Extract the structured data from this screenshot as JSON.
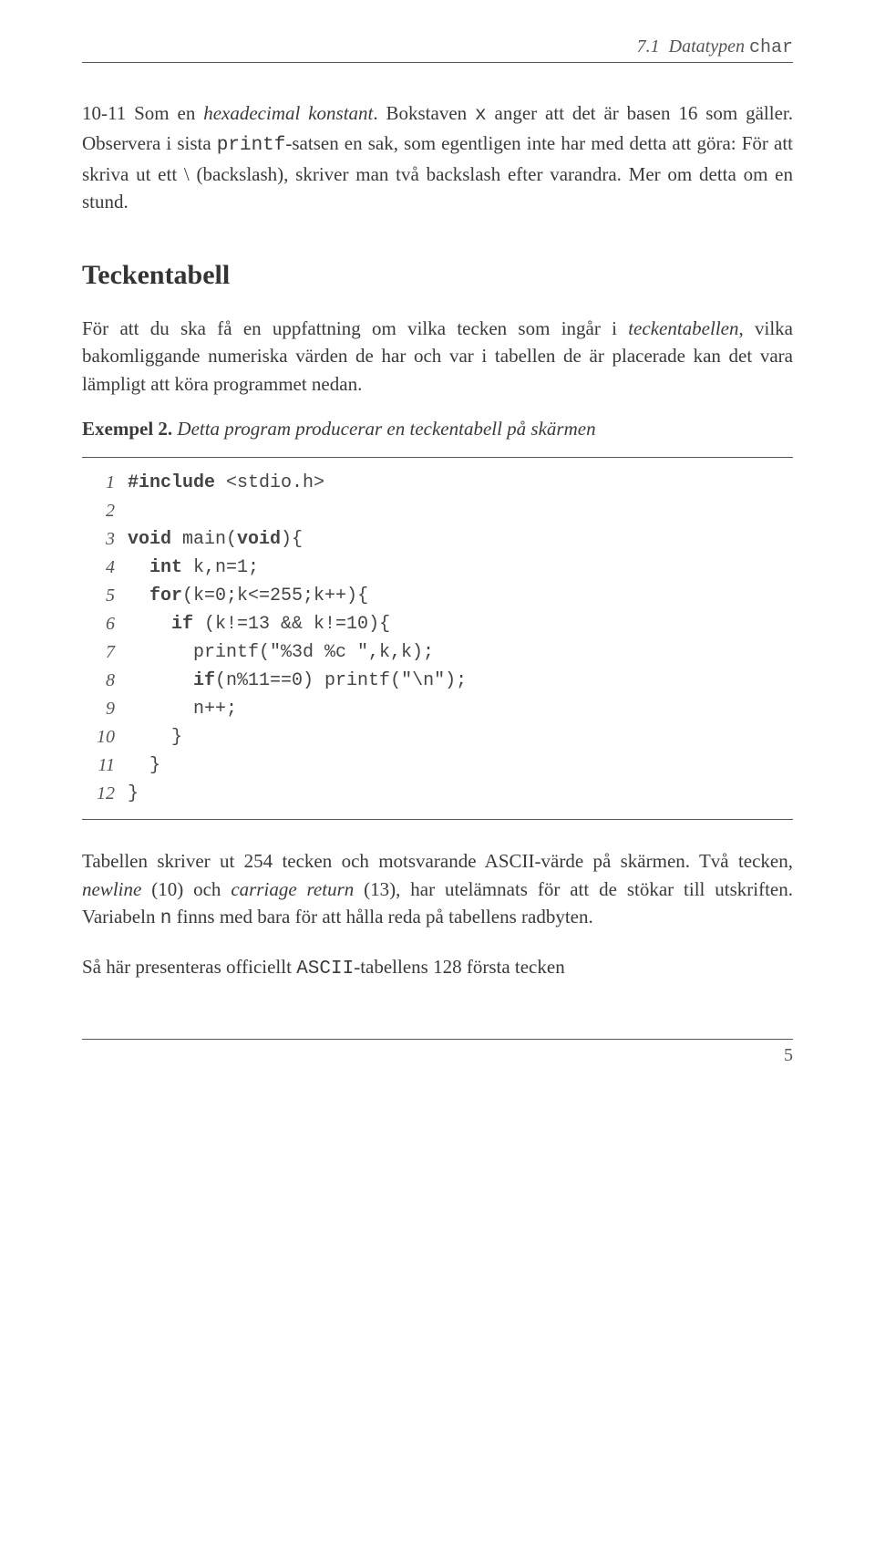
{
  "header": {
    "section_num": "7.1",
    "section_title_pre": "Datatypen ",
    "section_title_mono": "char"
  },
  "para1": {
    "lead_lines": "10-11",
    "t1": " Som en ",
    "i1": "hexadecimal konstant",
    "t2": ". Bokstaven ",
    "m1": "x",
    "t3": " anger att det är basen 16 som gäller. Observera i sista ",
    "m2": "printf",
    "t4": "-satsen en sak, som egentligen inte har med detta att göra: För att skriva ut ett \\ (backslash), skriver man två backslash efter varandra. Mer om detta om en stund."
  },
  "section_title": "Teckentabell",
  "para2": {
    "t1": "För att du ska få en uppfattning om vilka tecken som ingår i ",
    "i1": "teckentabellen",
    "t2": ", vilka bakomliggande numeriska värden de har och var i tabellen de är placerade kan det vara lämpligt att köra programmet nedan."
  },
  "exempel": {
    "label": "Exempel 2.",
    "desc": "Detta program producerar en teckentabell på skärmen"
  },
  "code": [
    {
      "n": "1",
      "pre": "",
      "kw": "#include",
      "post": " <stdio.h>"
    },
    {
      "n": "2",
      "pre": "",
      "kw": "",
      "post": ""
    },
    {
      "n": "3",
      "pre": "",
      "kw": "void",
      "post": " main(",
      "kw2": "void",
      "post2": "){"
    },
    {
      "n": "4",
      "pre": "  ",
      "kw": "int",
      "post": " k,n=1;"
    },
    {
      "n": "5",
      "pre": "  ",
      "kw": "for",
      "post": "(k=0;k<=255;k++){"
    },
    {
      "n": "6",
      "pre": "    ",
      "kw": "if",
      "post": " (k!=13 && k!=10){"
    },
    {
      "n": "7",
      "pre": "      ",
      "kw": "",
      "post": "printf(\"%3d %c \",k,k);"
    },
    {
      "n": "8",
      "pre": "      ",
      "kw": "if",
      "post": "(n%11==0) printf(\"\\n\");"
    },
    {
      "n": "9",
      "pre": "      ",
      "kw": "",
      "post": "n++;"
    },
    {
      "n": "10",
      "pre": "    ",
      "kw": "",
      "post": "}"
    },
    {
      "n": "11",
      "pre": "  ",
      "kw": "",
      "post": "}"
    },
    {
      "n": "12",
      "pre": "",
      "kw": "",
      "post": "}"
    }
  ],
  "para3": {
    "t1": "Tabellen skriver ut 254 tecken och motsvarande ASCII-värde på skärmen. Två tecken, ",
    "i1": "newline",
    "t2": " (10) och ",
    "i2": "carriage return",
    "t3": " (13), har utelämnats för att de stökar till utskriften. Variabeln ",
    "m1": "n",
    "t4": " finns med bara för att hålla reda på tabellens radbyten."
  },
  "para4": {
    "t1": "Så här presenteras officiellt ",
    "m1": "ASCII",
    "t2": "-tabellens 128 första tecken"
  },
  "page_number": "5"
}
